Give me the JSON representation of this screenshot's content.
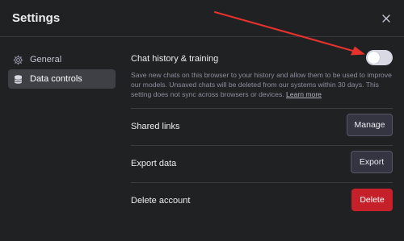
{
  "header": {
    "title": "Settings",
    "close_icon": "close-icon"
  },
  "sidebar": {
    "items": [
      {
        "label": "General",
        "icon": "gear-icon",
        "active": false
      },
      {
        "label": "Data controls",
        "icon": "database-icon",
        "active": true
      }
    ]
  },
  "data_controls": {
    "chat_history": {
      "title": "Chat history & training",
      "enabled": false,
      "description": "Save new chats on this browser to your history and allow them to be used to improve our models. Unsaved chats will be deleted from our systems within 30 days. This setting does not sync across browsers or devices.",
      "learn_more": "Learn more"
    },
    "shared_links": {
      "title": "Shared links",
      "button": "Manage"
    },
    "export_data": {
      "title": "Export data",
      "button": "Export"
    },
    "delete_account": {
      "title": "Delete account",
      "button": "Delete"
    }
  },
  "colors": {
    "background": "#202123",
    "danger": "#c6212b",
    "annotation_arrow": "#e5322d"
  }
}
